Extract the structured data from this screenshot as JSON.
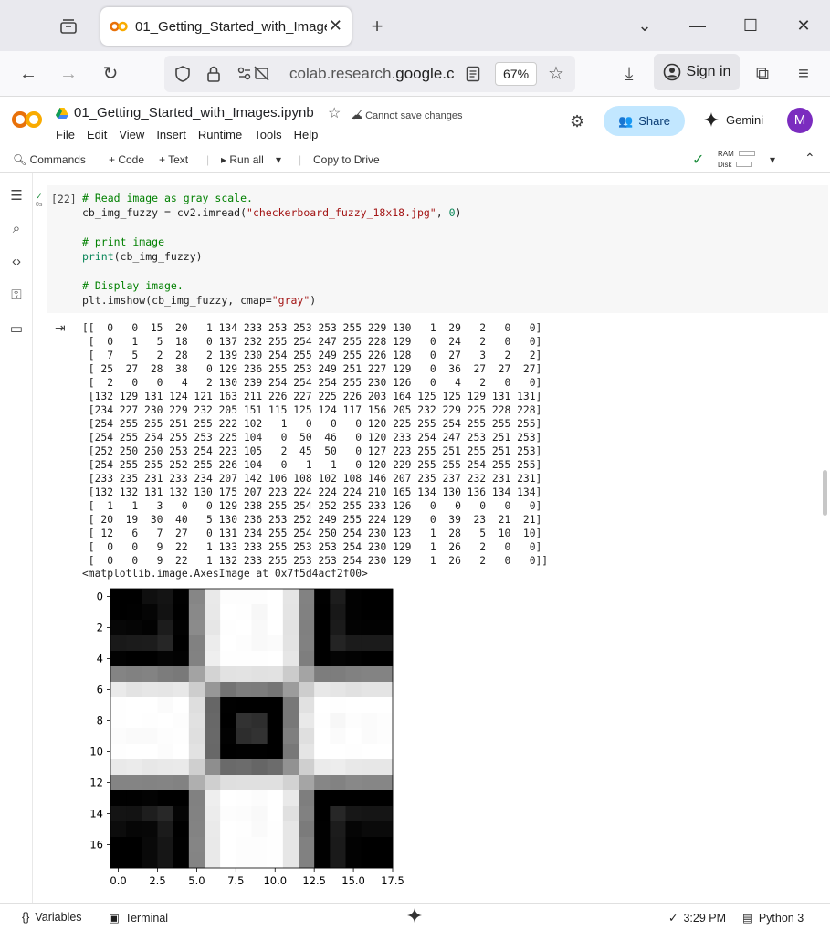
{
  "browser": {
    "tab_title": "01_Getting_Started_with_Images",
    "url_host_prefix": "colab.research.",
    "url_host_bold": "google.c",
    "zoom": "67%",
    "signin_label": "Sign in"
  },
  "colab": {
    "notebook_title": "01_Getting_Started_with_Images.ipynb",
    "cannot_save": "Cannot save changes",
    "menu": [
      "File",
      "Edit",
      "View",
      "Insert",
      "Runtime",
      "Tools",
      "Help"
    ],
    "share_label": "Share",
    "gemini_label": "Gemini",
    "avatar_letter": "M"
  },
  "toolbar": {
    "commands": "Commands",
    "code": "+ Code",
    "text": "+ Text",
    "run_all": "Run all",
    "copy_to_drive": "Copy to Drive",
    "ram": "RAM",
    "disk": "Disk"
  },
  "cell": {
    "exec_count": "[22]",
    "status_time": "0s",
    "code_lines": [
      [
        {
          "t": "# Read image as gray scale.",
          "c": "cm"
        }
      ],
      [
        {
          "t": "cb_img_fuzzy = cv2.imread(",
          "c": ""
        },
        {
          "t": "\"checkerboard_fuzzy_18x18.jpg\"",
          "c": "st"
        },
        {
          "t": ", ",
          "c": ""
        },
        {
          "t": "0",
          "c": "nu"
        },
        {
          "t": ")",
          "c": ""
        }
      ],
      [
        {
          "t": "",
          "c": ""
        }
      ],
      [
        {
          "t": "# print image",
          "c": "cm"
        }
      ],
      [
        {
          "t": "print",
          "c": "nu"
        },
        {
          "t": "(cb_img_fuzzy)",
          "c": ""
        }
      ],
      [
        {
          "t": "",
          "c": ""
        }
      ],
      [
        {
          "t": "# Display image.",
          "c": "cm"
        }
      ],
      [
        {
          "t": "plt.imshow(cb_img_fuzzy, cmap=",
          "c": ""
        },
        {
          "t": "\"gray\"",
          "c": "st"
        },
        {
          "t": ")",
          "c": ""
        }
      ]
    ]
  },
  "output": {
    "matrix": [
      [
        0,
        0,
        15,
        20,
        1,
        134,
        233,
        253,
        253,
        253,
        255,
        229,
        130,
        1,
        29,
        2,
        0,
        0
      ],
      [
        0,
        1,
        5,
        18,
        0,
        137,
        232,
        255,
        254,
        247,
        255,
        228,
        129,
        0,
        24,
        2,
        0,
        0
      ],
      [
        7,
        5,
        2,
        28,
        2,
        139,
        230,
        254,
        255,
        249,
        255,
        226,
        128,
        0,
        27,
        3,
        2,
        2
      ],
      [
        25,
        27,
        28,
        38,
        0,
        129,
        236,
        255,
        253,
        249,
        251,
        227,
        129,
        0,
        36,
        27,
        27,
        27
      ],
      [
        2,
        0,
        0,
        4,
        2,
        130,
        239,
        254,
        254,
        254,
        255,
        230,
        126,
        0,
        4,
        2,
        0,
        0
      ],
      [
        132,
        129,
        131,
        124,
        121,
        163,
        211,
        226,
        227,
        225,
        226,
        203,
        164,
        125,
        125,
        129,
        131,
        131
      ],
      [
        234,
        227,
        230,
        229,
        232,
        205,
        151,
        115,
        125,
        124,
        117,
        156,
        205,
        232,
        229,
        225,
        228,
        228
      ],
      [
        254,
        255,
        255,
        251,
        255,
        222,
        102,
        1,
        0,
        0,
        0,
        120,
        225,
        255,
        254,
        255,
        255,
        255
      ],
      [
        254,
        255,
        254,
        255,
        253,
        225,
        104,
        0,
        50,
        46,
        0,
        120,
        233,
        254,
        247,
        253,
        251,
        253
      ],
      [
        252,
        250,
        250,
        253,
        254,
        223,
        105,
        2,
        45,
        50,
        0,
        127,
        223,
        255,
        251,
        255,
        251,
        253
      ],
      [
        254,
        255,
        255,
        252,
        255,
        226,
        104,
        0,
        1,
        1,
        0,
        120,
        229,
        255,
        255,
        254,
        255,
        255
      ],
      [
        233,
        235,
        231,
        233,
        234,
        207,
        142,
        106,
        108,
        102,
        108,
        146,
        207,
        235,
        237,
        232,
        231,
        231
      ],
      [
        132,
        132,
        131,
        132,
        130,
        175,
        207,
        223,
        224,
        224,
        224,
        210,
        165,
        134,
        130,
        136,
        134,
        134
      ],
      [
        1,
        1,
        3,
        0,
        0,
        129,
        238,
        255,
        254,
        252,
        255,
        233,
        126,
        0,
        0,
        0,
        0,
        0
      ],
      [
        20,
        19,
        30,
        40,
        5,
        130,
        236,
        253,
        252,
        249,
        255,
        224,
        129,
        0,
        39,
        23,
        21,
        21
      ],
      [
        12,
        6,
        7,
        27,
        0,
        131,
        234,
        255,
        254,
        250,
        254,
        230,
        123,
        1,
        28,
        5,
        10,
        10
      ],
      [
        0,
        0,
        9,
        22,
        1,
        133,
        233,
        255,
        253,
        253,
        254,
        230,
        129,
        1,
        26,
        2,
        0,
        0
      ],
      [
        0,
        0,
        9,
        22,
        1,
        132,
        233,
        255,
        253,
        253,
        254,
        230,
        129,
        1,
        26,
        2,
        0,
        0
      ]
    ],
    "repr": "<matplotlib.image.AxesImage at 0x7f5d4acf2f00>"
  },
  "chart_data": {
    "type": "heatmap",
    "colormap": "gray",
    "x_ticks": [
      "0.0",
      "2.5",
      "5.0",
      "7.5",
      "10.0",
      "12.5",
      "15.0",
      "17.5"
    ],
    "y_ticks": [
      "0",
      "2",
      "4",
      "6",
      "8",
      "10",
      "12",
      "14",
      "16"
    ],
    "xlim": [
      -0.5,
      17.5
    ],
    "ylim": [
      17.5,
      -0.5
    ],
    "values_ref": "output.matrix"
  },
  "statusbar": {
    "variables": "Variables",
    "terminal": "Terminal",
    "time": "3:29 PM",
    "runtime": "Python 3"
  }
}
